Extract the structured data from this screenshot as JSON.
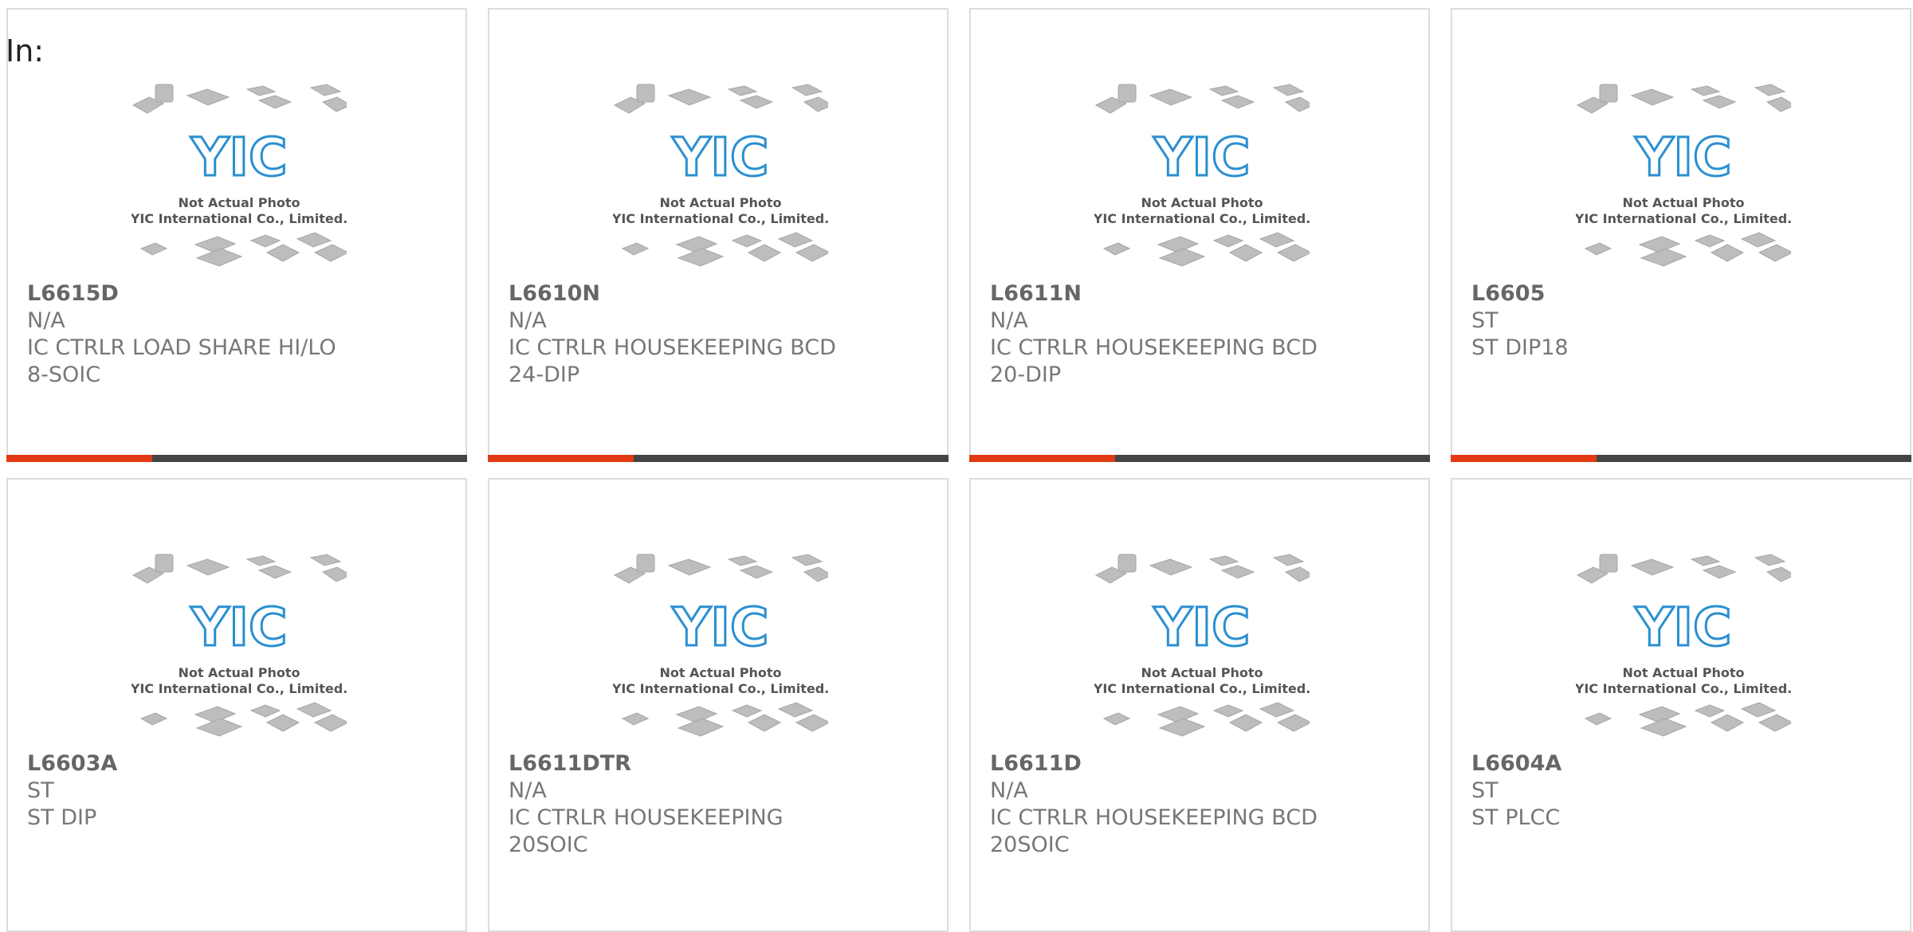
{
  "header": {
    "in_label": "In:"
  },
  "colors": {
    "accent": "#e23a12",
    "bar": "#444444",
    "logo": "#2a8fd0"
  },
  "placeholder_image": {
    "line1": "Not Actual Photo",
    "line2": "YIC International Co., Limited.",
    "logo_text": "YIC"
  },
  "products": [
    {
      "part": "L6615D",
      "mfr": "N/A",
      "desc": "IC CTRLR LOAD SHARE HI/LO 8-SOIC"
    },
    {
      "part": "L6610N",
      "mfr": "N/A",
      "desc": "IC CTRLR HOUSEKEEPING BCD 24-DIP"
    },
    {
      "part": "L6611N",
      "mfr": "N/A",
      "desc": "IC CTRLR HOUSEKEEPING BCD 20-DIP"
    },
    {
      "part": "L6605",
      "mfr": "ST",
      "desc": "ST DIP18"
    },
    {
      "part": "L6603A",
      "mfr": "ST",
      "desc": "ST DIP"
    },
    {
      "part": "L6611DTR",
      "mfr": "N/A",
      "desc": "IC CTRLR HOUSEKEEPING 20SOIC"
    },
    {
      "part": "L6611D",
      "mfr": "N/A",
      "desc": "IC CTRLR HOUSEKEEPING BCD 20SOIC"
    },
    {
      "part": "L6604A",
      "mfr": "ST",
      "desc": "ST PLCC"
    }
  ]
}
